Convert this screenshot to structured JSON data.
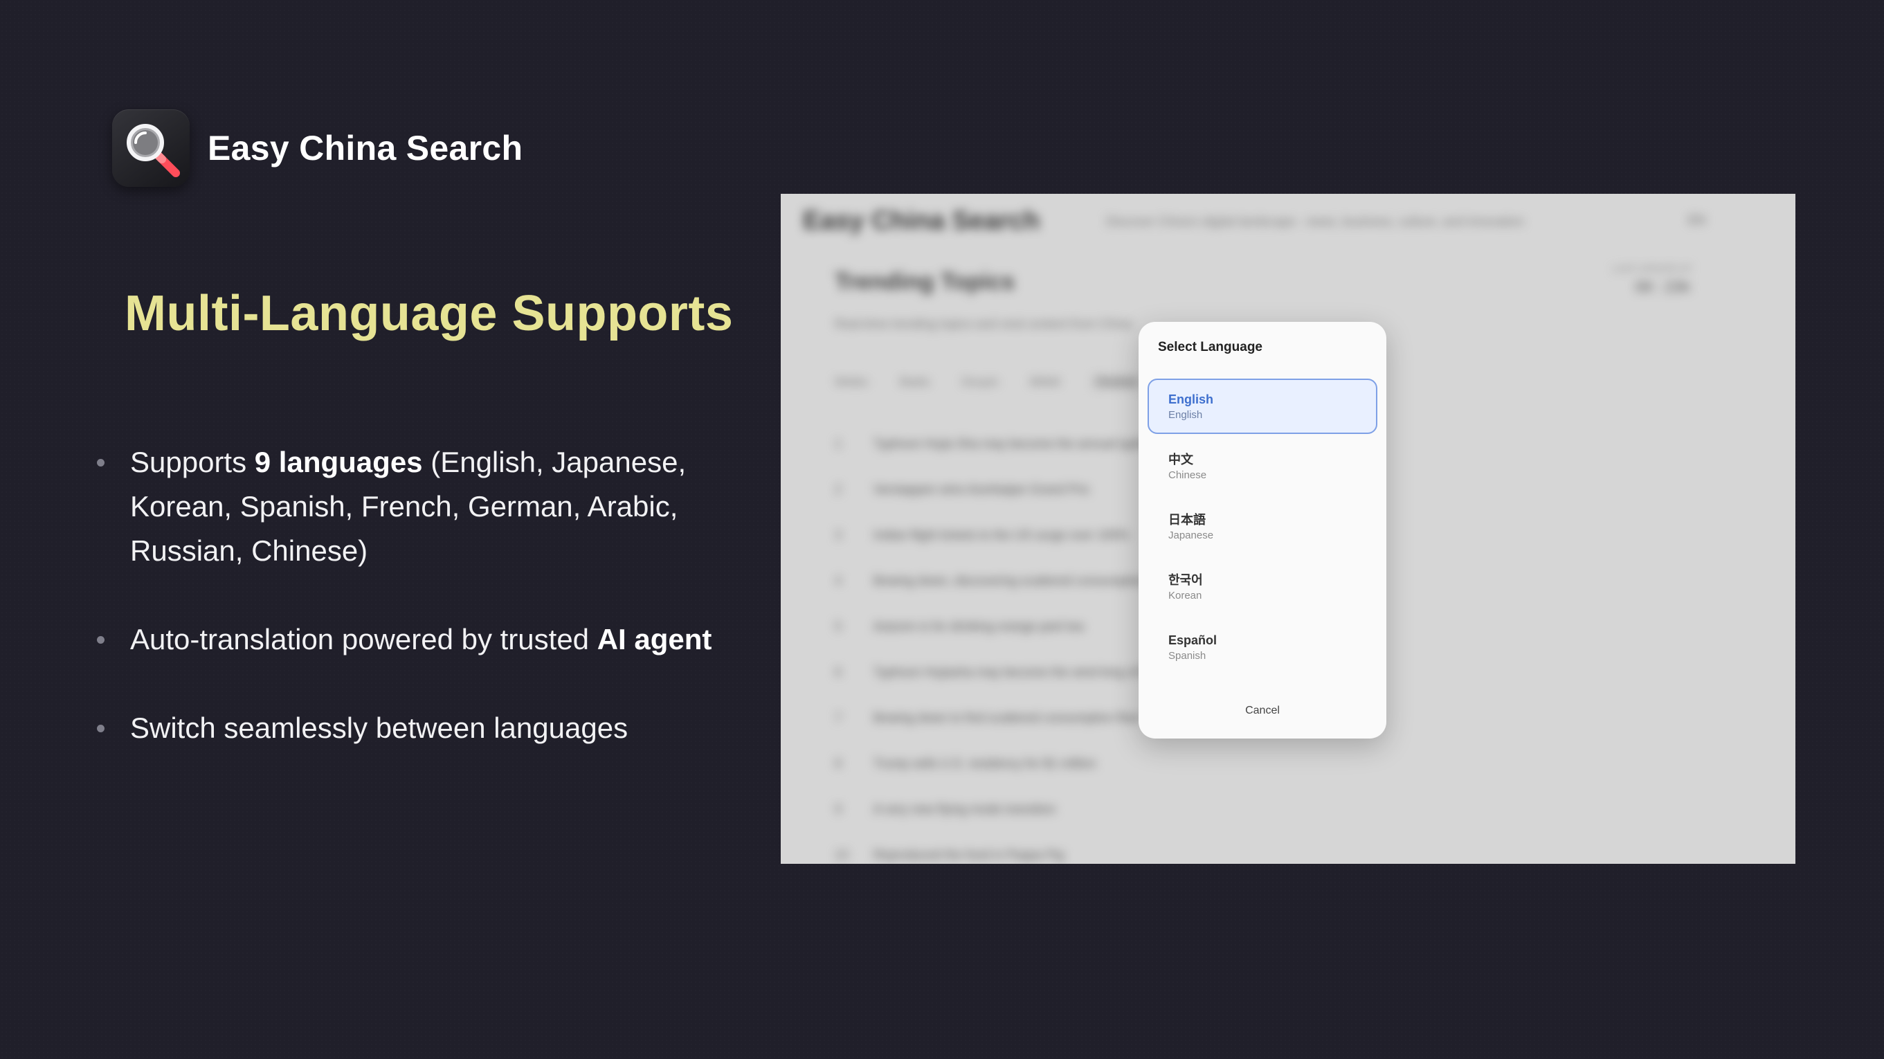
{
  "brand": {
    "name": "Easy China Search",
    "icon": "magnifier-icon"
  },
  "heading": "Multi-Language Supports",
  "bullets": {
    "b1_pre": "Supports ",
    "b1_bold": "9 languages",
    "b1_post": " (English, Japanese, Korean, Spanish, French, German, Arabic, Russian, Chinese)",
    "b2_pre": "Auto-translation powered by trusted ",
    "b2_bold": "AI agent",
    "b3": "Switch seamlessly between languages"
  },
  "screenshot": {
    "app_title": "Easy China Search",
    "tagline": "Discover China's digital landscape - news, business, culture, and innovation",
    "lang_toggle": "EN",
    "section_title": "Trending Topics",
    "section_subtitle": "Real-time trending topics and viral content from China",
    "update_label": "LAST UPDATE AT",
    "update_time": "09 : 23h",
    "tabs": [
      "Weibo",
      "Baidu",
      "Douyin",
      "Bilibili",
      "Toutiao",
      "Zhihu",
      "Douban",
      "Movie"
    ],
    "active_tab_index": 4,
    "rows": [
      {
        "num": "1",
        "title": "Typhoon Hujia Sha may become the annual typhoon king"
      },
      {
        "num": "2",
        "title": "Verstappen wins Azerbaijan Grand Prix"
      },
      {
        "num": "3",
        "title": "Indian flight tickets to the US surge over 100%"
      },
      {
        "num": "4",
        "title": "Bowing down, discovering scattered consumption"
      },
      {
        "num": "5",
        "title": "Autumn is for drinking orange peel tea"
      },
      {
        "num": "6",
        "title": "Typhoon Hujiasha may become the wind king of the year"
      },
      {
        "num": "7",
        "title": "Bowing down to find scattered consumption flow"
      },
      {
        "num": "8",
        "title": "Trump sells U.S. residency for $1 million"
      },
      {
        "num": "9",
        "title": "A very new flying mode transition"
      },
      {
        "num": "10",
        "title": "Reproduced the food in Peppa Pig"
      }
    ]
  },
  "modal": {
    "title": "Select Language",
    "options": [
      {
        "native": "English",
        "english": "English",
        "selected": true
      },
      {
        "native": "中文",
        "english": "Chinese",
        "selected": false
      },
      {
        "native": "日本語",
        "english": "Japanese",
        "selected": false
      },
      {
        "native": "한국어",
        "english": "Korean",
        "selected": false
      },
      {
        "native": "Español",
        "english": "Spanish",
        "selected": false
      }
    ],
    "cancel_label": "Cancel"
  },
  "colors": {
    "background": "#201f2a",
    "heading": "#e6e394",
    "selected_accent": "#3e6fce"
  }
}
